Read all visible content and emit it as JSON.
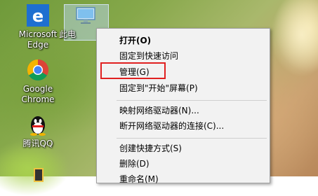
{
  "desktop": {
    "icons": [
      {
        "label_line1": "Microsoft",
        "label_line2": "Edge",
        "icon": "edge-icon"
      },
      {
        "label_line1": "Google",
        "label_line2": "Chrome",
        "icon": "chrome-icon"
      },
      {
        "label_line1": "腾讯QQ",
        "label_line2": "",
        "icon": "qq-icon"
      },
      {
        "label_line1": "此电",
        "label_line2": "",
        "icon": "this-pc-icon"
      }
    ]
  },
  "context_menu": {
    "items": [
      {
        "label": "打开(O)",
        "bold": true
      },
      {
        "label": "固定到快速访问"
      },
      {
        "label": "管理(G)",
        "highlighted": true
      },
      {
        "label": "固定到\"开始\"屏幕(P)"
      },
      {
        "label": "映射网络驱动器(N)..."
      },
      {
        "label": "断开网络驱动器的连接(C)..."
      },
      {
        "label": "创建快捷方式(S)"
      },
      {
        "label": "删除(D)"
      },
      {
        "label": "重命名(M)"
      }
    ]
  },
  "colors": {
    "highlight_border": "#e02020",
    "menu_bg": "#f2f2f2"
  }
}
